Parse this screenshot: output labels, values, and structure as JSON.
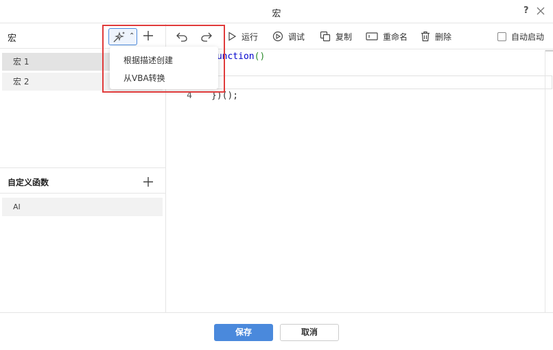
{
  "window": {
    "title": "宏",
    "help": "?"
  },
  "sidebar": {
    "title": "宏",
    "items": [
      {
        "label": "宏 1"
      },
      {
        "label": "宏 2"
      }
    ],
    "functions": {
      "title": "自定义函数",
      "items": [
        {
          "label": "AI"
        }
      ]
    }
  },
  "dropdown": {
    "items": [
      {
        "label": "根据描述创建"
      },
      {
        "label": "从VBA转换"
      }
    ]
  },
  "toolbar": {
    "run": "运行",
    "debug": "调试",
    "copy": "复制",
    "rename": "重命名",
    "delete": "删除",
    "auto_start": "自动启动"
  },
  "editor": {
    "lines": [
      {
        "number": "",
        "keyword": "function",
        "paren": "()",
        "punct": ""
      },
      {
        "number": "4",
        "keyword": "",
        "paren": "",
        "punct": "})();"
      }
    ]
  },
  "footer": {
    "save": "保存",
    "cancel": "取消"
  },
  "colors": {
    "accent": "#4a89dc",
    "highlight_border": "#e03b3b",
    "keyword": "#0000cc",
    "paren": "#2a8a2a"
  }
}
